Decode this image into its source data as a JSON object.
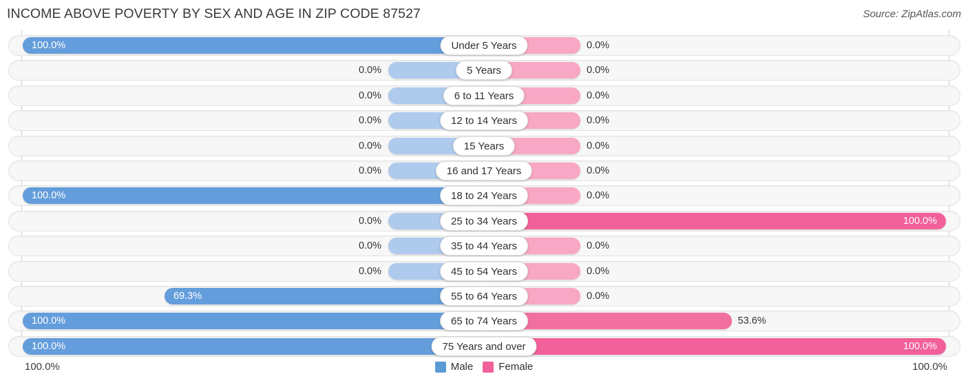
{
  "header": {
    "title": "INCOME ABOVE POVERTY BY SEX AND AGE IN ZIP CODE 87527",
    "source": "Source: ZipAtlas.com"
  },
  "legend": {
    "male_label": "Male",
    "female_label": "Female",
    "male_color": "#5b9bd5",
    "female_color": "#f0609b"
  },
  "axis": {
    "left_label": "100.0%",
    "right_label": "100.0%"
  },
  "colors": {
    "male_strong": "#649ddb",
    "male_weak": "#aecbee",
    "female_strong": "#f2609a",
    "female_mid": "#f2709f",
    "female_weak": "#f8a8c4",
    "track_fill": "#f7f7f7",
    "track_border": "#e3e3e3",
    "gridline": "#c9c9c9"
  },
  "chart_data": {
    "type": "bar",
    "title": "INCOME ABOVE POVERTY BY SEX AND AGE IN ZIP CODE 87527",
    "subtype": "diverging-horizontal-bar",
    "xlabel": "",
    "ylabel": "",
    "xlim": [
      0,
      100
    ],
    "grid": true,
    "legend_position": "bottom-center",
    "categories": [
      "Under 5 Years",
      "5 Years",
      "6 to 11 Years",
      "12 to 14 Years",
      "15 Years",
      "16 and 17 Years",
      "18 to 24 Years",
      "25 to 34 Years",
      "35 to 44 Years",
      "45 to 54 Years",
      "55 to 64 Years",
      "65 to 74 Years",
      "75 Years and over"
    ],
    "series": [
      {
        "name": "Male",
        "values": [
          100.0,
          0.0,
          0.0,
          0.0,
          0.0,
          0.0,
          100.0,
          0.0,
          0.0,
          0.0,
          69.3,
          100.0,
          100.0
        ],
        "labels": [
          "100.0%",
          "0.0%",
          "0.0%",
          "0.0%",
          "0.0%",
          "0.0%",
          "100.0%",
          "0.0%",
          "0.0%",
          "0.0%",
          "69.3%",
          "100.0%",
          "100.0%"
        ]
      },
      {
        "name": "Female",
        "values": [
          0.0,
          0.0,
          0.0,
          0.0,
          0.0,
          0.0,
          0.0,
          100.0,
          0.0,
          0.0,
          0.0,
          53.6,
          100.0
        ],
        "labels": [
          "0.0%",
          "0.0%",
          "0.0%",
          "0.0%",
          "0.0%",
          "0.0%",
          "0.0%",
          "100.0%",
          "0.0%",
          "0.0%",
          "0.0%",
          "53.6%",
          "100.0%"
        ]
      }
    ]
  },
  "rows": [
    {
      "category": "Under 5 Years",
      "male": {
        "label": "100.0%",
        "value": 100.0,
        "inside": true,
        "color": "#649ddb"
      },
      "female": {
        "label": "0.0%",
        "value": 0.0,
        "inside": false,
        "color": "#f8a8c4"
      }
    },
    {
      "category": "5 Years",
      "male": {
        "label": "0.0%",
        "value": 0.0,
        "inside": false,
        "color": "#aecbee"
      },
      "female": {
        "label": "0.0%",
        "value": 0.0,
        "inside": false,
        "color": "#f8a8c4"
      }
    },
    {
      "category": "6 to 11 Years",
      "male": {
        "label": "0.0%",
        "value": 0.0,
        "inside": false,
        "color": "#aecbee"
      },
      "female": {
        "label": "0.0%",
        "value": 0.0,
        "inside": false,
        "color": "#f8a8c4"
      }
    },
    {
      "category": "12 to 14 Years",
      "male": {
        "label": "0.0%",
        "value": 0.0,
        "inside": false,
        "color": "#aecbee"
      },
      "female": {
        "label": "0.0%",
        "value": 0.0,
        "inside": false,
        "color": "#f8a8c4"
      }
    },
    {
      "category": "15 Years",
      "male": {
        "label": "0.0%",
        "value": 0.0,
        "inside": false,
        "color": "#aecbee"
      },
      "female": {
        "label": "0.0%",
        "value": 0.0,
        "inside": false,
        "color": "#f8a8c4"
      }
    },
    {
      "category": "16 and 17 Years",
      "male": {
        "label": "0.0%",
        "value": 0.0,
        "inside": false,
        "color": "#aecbee"
      },
      "female": {
        "label": "0.0%",
        "value": 0.0,
        "inside": false,
        "color": "#f8a8c4"
      }
    },
    {
      "category": "18 to 24 Years",
      "male": {
        "label": "100.0%",
        "value": 100.0,
        "inside": true,
        "color": "#649ddb"
      },
      "female": {
        "label": "0.0%",
        "value": 0.0,
        "inside": false,
        "color": "#f8a8c4"
      }
    },
    {
      "category": "25 to 34 Years",
      "male": {
        "label": "0.0%",
        "value": 0.0,
        "inside": false,
        "color": "#aecbee"
      },
      "female": {
        "label": "100.0%",
        "value": 100.0,
        "inside": true,
        "color": "#f2609a"
      }
    },
    {
      "category": "35 to 44 Years",
      "male": {
        "label": "0.0%",
        "value": 0.0,
        "inside": false,
        "color": "#aecbee"
      },
      "female": {
        "label": "0.0%",
        "value": 0.0,
        "inside": false,
        "color": "#f8a8c4"
      }
    },
    {
      "category": "45 to 54 Years",
      "male": {
        "label": "0.0%",
        "value": 0.0,
        "inside": false,
        "color": "#aecbee"
      },
      "female": {
        "label": "0.0%",
        "value": 0.0,
        "inside": false,
        "color": "#f8a8c4"
      }
    },
    {
      "category": "55 to 64 Years",
      "male": {
        "label": "69.3%",
        "value": 69.3,
        "inside": true,
        "color": "#649ddb"
      },
      "female": {
        "label": "0.0%",
        "value": 0.0,
        "inside": false,
        "color": "#f8a8c4"
      }
    },
    {
      "category": "65 to 74 Years",
      "male": {
        "label": "100.0%",
        "value": 100.0,
        "inside": true,
        "color": "#649ddb"
      },
      "female": {
        "label": "53.6%",
        "value": 53.6,
        "inside": false,
        "color": "#f2709f"
      }
    },
    {
      "category": "75 Years and over",
      "male": {
        "label": "100.0%",
        "value": 100.0,
        "inside": true,
        "color": "#649ddb"
      },
      "female": {
        "label": "100.0%",
        "value": 100.0,
        "inside": true,
        "color": "#f2609a"
      }
    }
  ]
}
